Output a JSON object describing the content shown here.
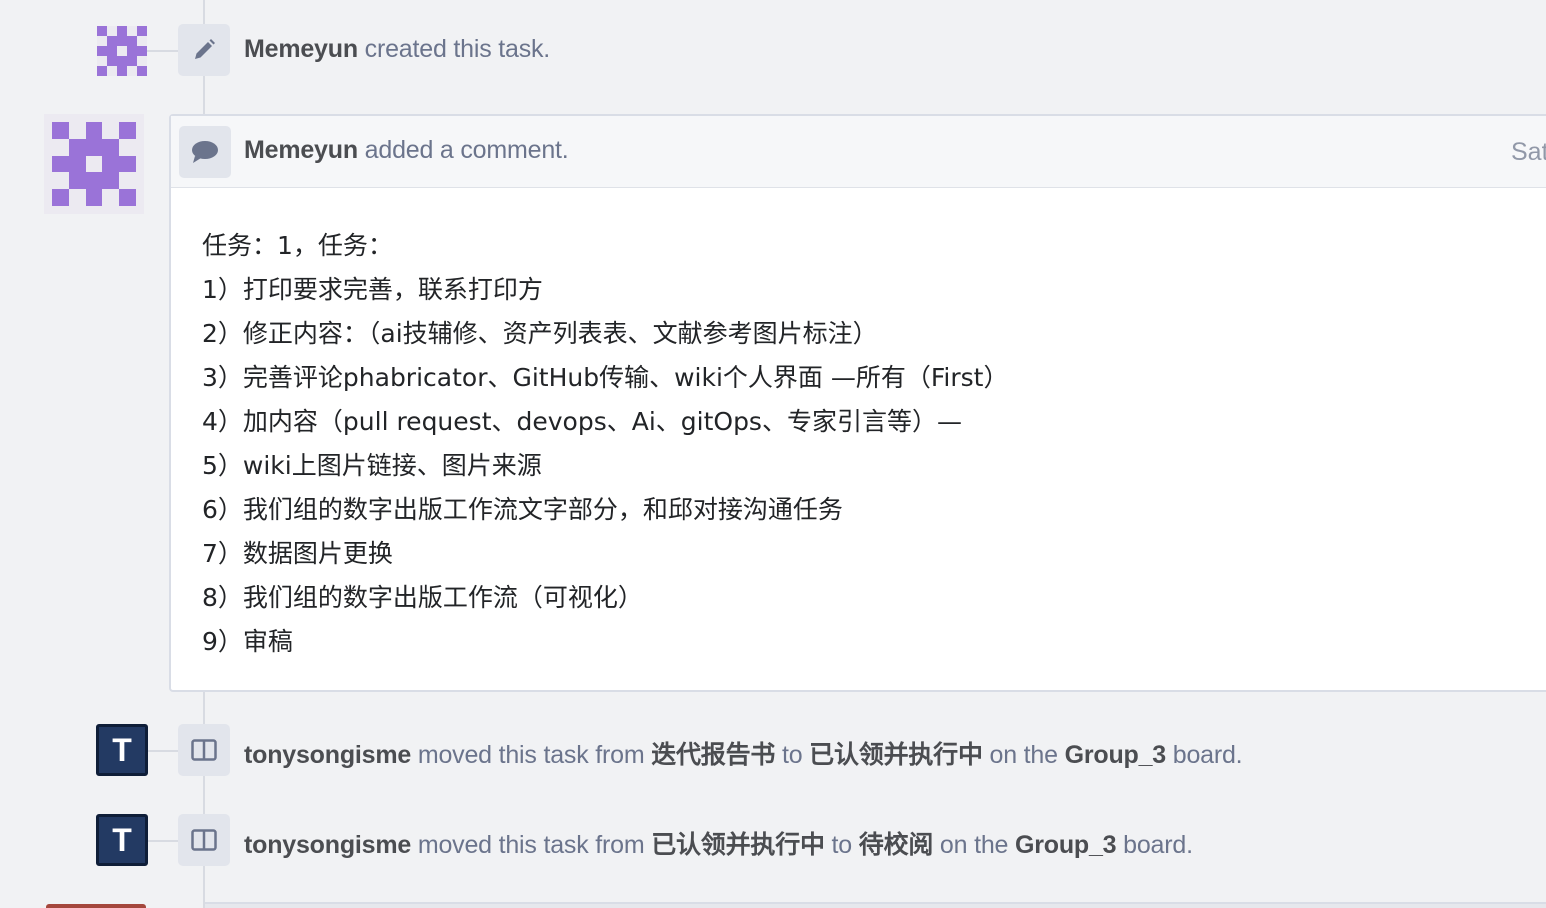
{
  "colors": {
    "background": "#f1f2f4",
    "identicon": "#9a73d8",
    "user_avatar": "#233a63",
    "muted_text": "#6b748c",
    "bold_text": "#4b4d51"
  },
  "stories": {
    "created": {
      "icon": "pencil-icon",
      "author": "Memeyun",
      "action": " created this task."
    },
    "comment": {
      "icon": "comment-icon",
      "author": "Memeyun",
      "action": " added a comment.",
      "date": "Sat,",
      "lines": [
        "任务：1，任务：",
        "1）打印要求完善，联系打印方",
        "2）修正内容：（ai技辅修、资产列表表、文献参考图片标注）",
        "3）完善评论phabricator、GitHub传输、wiki个人界面 —所有（First）",
        "4）加内容（pull request、devops、Ai、gitOps、专家引言等）—",
        "5）wiki上图片链接、图片来源",
        "6）我们组的数字出版工作流文字部分，和邱对接沟通任务",
        "7）数据图片更换",
        "8）我们组的数字出版工作流（可视化）",
        "9）审稿"
      ]
    },
    "move1": {
      "icon": "board-columns-icon",
      "avatar_letter": "T",
      "author": "tonysongisme",
      "t1": " moved this task from ",
      "from": "迭代报告书",
      "t2": " to ",
      "to": "已认领并执行中",
      "t3": " on the ",
      "board": "Group_3",
      "t4": " board."
    },
    "move2": {
      "icon": "board-columns-icon",
      "avatar_letter": "T",
      "author": "tonysongisme",
      "t1": " moved this task from ",
      "from": "已认领并执行中",
      "t2": " to ",
      "to": "待校阅",
      "t3": " on the ",
      "board": "Group_3",
      "t4": " board."
    }
  }
}
